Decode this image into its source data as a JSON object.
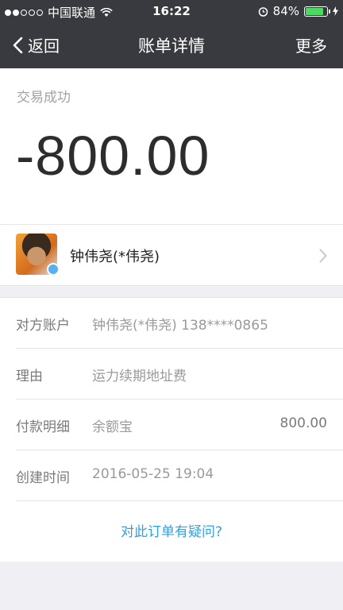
{
  "status_bar": {
    "carrier": "中国联通",
    "time": "16:22",
    "battery_percent": "84%",
    "battery_level": 0.84,
    "signal_dots": 5,
    "signal_filled": 2
  },
  "nav": {
    "back_label": "返回",
    "title": "账单详情",
    "more_label": "更多"
  },
  "summary": {
    "status": "交易成功",
    "amount": "-800.00"
  },
  "payee": {
    "name": "钟伟尧(*伟尧)"
  },
  "details": [
    {
      "label": "对方账户",
      "value": "钟伟尧(*伟尧) 138****0865",
      "amount": ""
    },
    {
      "label": "理由",
      "value": "运力续期地址费",
      "amount": ""
    },
    {
      "label": "付款明细",
      "value": "余额宝",
      "amount": "800.00"
    },
    {
      "label": "创建时间",
      "value": "2016-05-25 19:04",
      "amount": ""
    }
  ],
  "question_link": "对此订单有疑问?",
  "colors": {
    "nav_bg": "#393a3f",
    "link": "#2ba3e8",
    "battery": "#4cd964"
  }
}
